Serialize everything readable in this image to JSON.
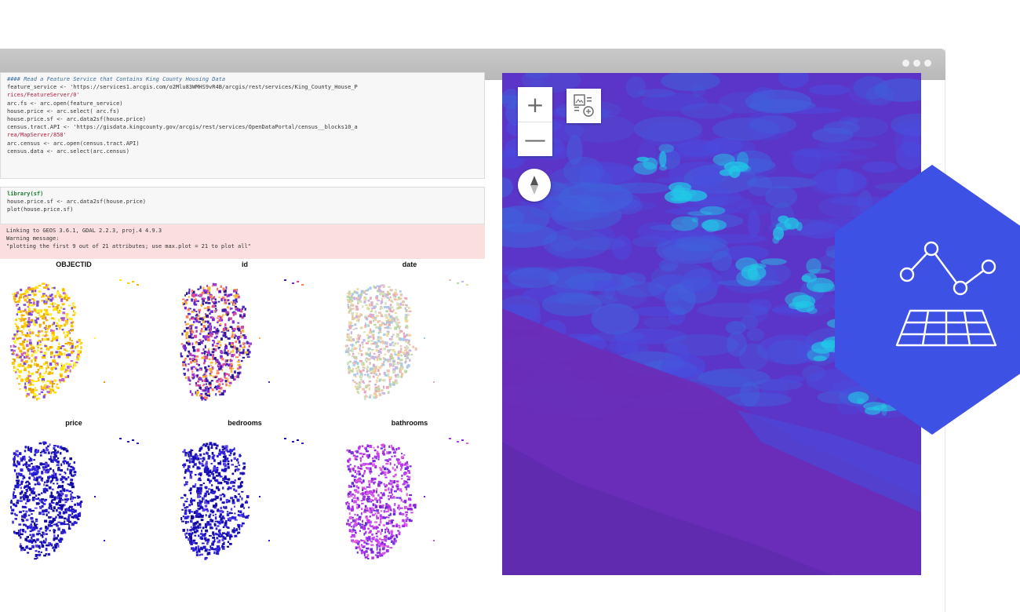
{
  "notebook": {
    "cell1": {
      "lines": [
        {
          "t": "#### Read a Feature Service that Contains King County Housing Data",
          "c": "c-comment"
        },
        {
          "t": "feature_service <- 'https://services1.arcgis.com/o2Mlu83WMHS9vR4B/arcgis/rest/services/King_County_House_P",
          "c": ""
        },
        {
          "t": "rices/FeatureServer/0'",
          "c": "c-string"
        },
        {
          "t": "arc.fs <- arc.open(feature_service)",
          "c": ""
        },
        {
          "t": "house.price <- arc.select( arc.fs)",
          "c": ""
        },
        {
          "t": "house.price.sf <- arc.data2sf(house.price)",
          "c": ""
        },
        {
          "t": "census.tract.API <- 'https://gisdata.kingcounty.gov/arcgis/rest/services/OpenDataPortal/census__blocks10_a",
          "c": ""
        },
        {
          "t": "rea/MapServer/858'",
          "c": "c-string"
        },
        {
          "t": "arc.census <- arc.open(census.tract.API)",
          "c": ""
        },
        {
          "t": "census.data <- arc.select(arc.census)",
          "c": ""
        }
      ]
    },
    "cell2": {
      "lines": [
        {
          "t": "library(sf)",
          "c": "c-kw"
        },
        {
          "t": "house.price.sf <- arc.data2sf(house.price)",
          "c": ""
        },
        {
          "t": "plot(house.price.sf)",
          "c": ""
        }
      ]
    },
    "warning": {
      "lines": [
        "Linking to GEOS 3.6.1, GDAL 2.2.3, proj.4 4.9.3",
        "Warning message:",
        "\"plotting the first 9 out of 21 attributes; use max.plot = 21 to plot all\""
      ]
    },
    "plots": [
      {
        "title": "OBJECTID",
        "scheme": "yellow"
      },
      {
        "title": "id",
        "scheme": "mixed"
      },
      {
        "title": "date",
        "scheme": "pastel"
      },
      {
        "title": "price",
        "scheme": "blue"
      },
      {
        "title": "bedrooms",
        "scheme": "blue"
      },
      {
        "title": "bathrooms",
        "scheme": "purple"
      }
    ]
  },
  "map": {
    "zoom_in": "+",
    "zoom_out": "—",
    "base_color": "#5b35c8",
    "valley_color": "#6a2db8",
    "highlight_color": "#21c9e6"
  },
  "badge": {
    "color": "#3d52e4",
    "icon": "line-chart-over-grid-icon"
  },
  "window": {
    "menu_icon": "more-dots-icon"
  }
}
